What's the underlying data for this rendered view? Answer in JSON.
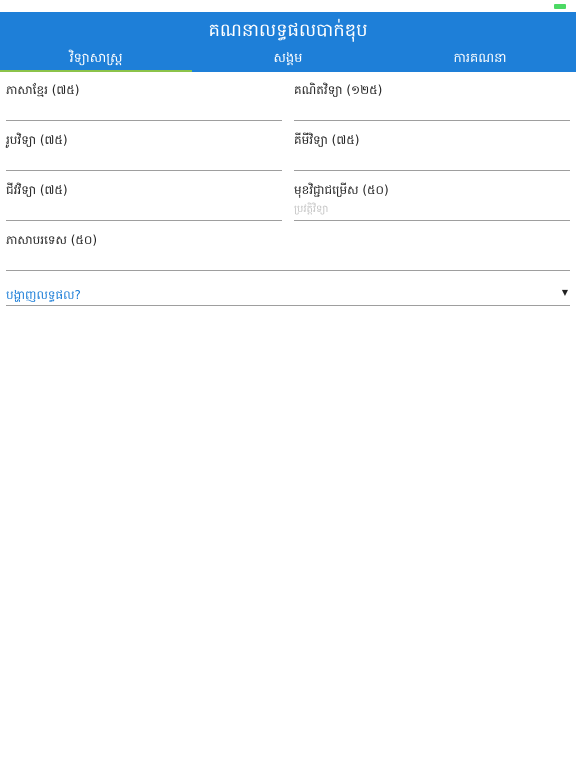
{
  "header": {
    "title": "គណនាលទ្ធផលបាក់ឌុប"
  },
  "tabs": [
    {
      "label": "វិទ្យាសាស្ត្រ",
      "active": true
    },
    {
      "label": "សង្គម",
      "active": false
    },
    {
      "label": "ការគណនា",
      "active": false
    }
  ],
  "fields": {
    "khmer": {
      "label": "ភាសាខ្មែរ (៧៥)",
      "value": "",
      "placeholder": ""
    },
    "math": {
      "label": "គណិតវិទ្យា (១២៥)",
      "value": "",
      "placeholder": ""
    },
    "physics": {
      "label": "រូបវិទ្យា (៧៥)",
      "value": "",
      "placeholder": ""
    },
    "chemistry": {
      "label": "គីមីវិទ្យា (៧៥)",
      "value": "",
      "placeholder": ""
    },
    "biology": {
      "label": "ជីវវិទ្យា (៧៥)",
      "value": "",
      "placeholder": ""
    },
    "elective": {
      "label": "មុខវិជ្ជាជម្រើស (៥០)",
      "value": "",
      "placeholder": "ប្រវត្តិវិទ្យា"
    },
    "foreign": {
      "label": "ភាសាបរទេស (៥០)",
      "value": "",
      "placeholder": ""
    }
  },
  "result_dropdown": {
    "label": "បង្ហាញលទ្ធផល?",
    "arrow": "▼"
  },
  "colors": {
    "primary": "#1e7fd8",
    "tab_indicator": "#8bc34a",
    "battery": "#4cd964"
  }
}
